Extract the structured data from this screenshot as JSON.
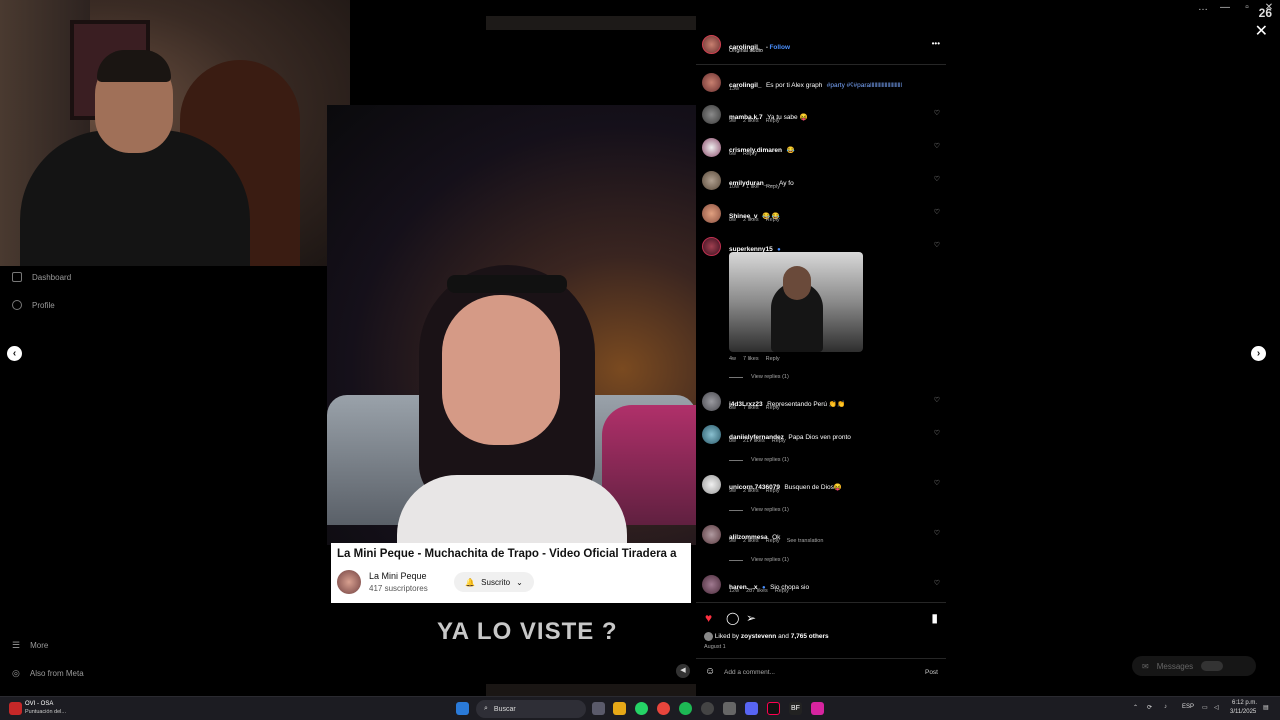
{
  "window": {
    "corner_number": "26",
    "controls": [
      "…",
      "—",
      "▫",
      "✕"
    ],
    "close_icon": "✕"
  },
  "sidebar": {
    "items": [
      {
        "label": "Dashboard",
        "icon": "dashboard-icon"
      },
      {
        "label": "Profile",
        "icon": "profile-icon"
      },
      {
        "label": "More",
        "icon": "menu-icon"
      },
      {
        "label": "Also from Meta",
        "icon": "meta-icon"
      }
    ]
  },
  "video": {
    "yt_title": "La Mini Peque - Muchachita de Trapo - Video Oficial Tiradera a",
    "yt_channel": "La Mini Peque",
    "yt_subscribers": "417 suscriptores",
    "yt_subscribe_label": "Suscrito",
    "overlay_text": "YA LO VISTE ?"
  },
  "post": {
    "author": "carolingil_",
    "follow_label": "Follow",
    "audio": "Original audio",
    "more_icon": "•••",
    "caption_user": "carolingil_",
    "caption_text": "Es por ti Alex graph",
    "caption_tags": "#party #ʕ#parallllllllllllllllllllll",
    "caption_time": "13w"
  },
  "comments": [
    {
      "user": "mamba.k.7",
      "text": "Ya tu sabe 😝",
      "time": "9w",
      "likes": "2 likes",
      "reply": "Reply"
    },
    {
      "user": "crismely.dimaren",
      "text": "😂",
      "time": "6w",
      "likes": "",
      "reply": "Reply"
    },
    {
      "user": "emilyduran___",
      "text": "Ay fo",
      "time": "10w",
      "likes": "1 like",
      "reply": "Reply"
    },
    {
      "user": "Shinee_v",
      "text": "😂 😂",
      "time": "8w",
      "likes": "2 likes",
      "reply": "Reply"
    },
    {
      "user": "superkenny15",
      "text": "",
      "time": "4w",
      "likes": "7 likes",
      "reply": "Reply",
      "view_replies": "View replies (1)"
    },
    {
      "user": "j4d3Lrxz23",
      "text": "Representando Perú 👏👏",
      "time": "8w",
      "likes": "7 likes",
      "reply": "Reply"
    },
    {
      "user": "daniielyfernandez",
      "text": "Papa Dios ven pronto",
      "time": "8w",
      "likes": "217 likes",
      "reply": "Reply",
      "view_replies": "View replies (1)"
    },
    {
      "user": "unicorn.7436079",
      "text": "Busquen de Dios😝",
      "time": "9w",
      "likes": "2 likes",
      "reply": "Reply",
      "view_replies": "View replies (1)"
    },
    {
      "user": "alilzommesa",
      "text": "Ok",
      "time": "9w",
      "likes": "2 likes",
      "reply": "Reply",
      "extra": "See translation",
      "view_replies": "View replies (1)"
    },
    {
      "user": "haren._.x",
      "text": "Sio chopa sio",
      "time": "12w",
      "likes": "287 likes",
      "reply": "Reply"
    }
  ],
  "footer": {
    "liked_by_prefix": "Liked by",
    "liked_by_user": "zoystevenn",
    "liked_by_and": "and",
    "liked_by_count": "7,765 others",
    "date": "August 1",
    "add_comment_placeholder": "Add a comment...",
    "post_label": "Post"
  },
  "messages_label": "Messages",
  "taskbar": {
    "app_title": "OVI - OSA",
    "app_subtitle": "Puntuación del...",
    "search_label": "Buscar",
    "lang": "ESP",
    "time": "6:12 p.m.",
    "date": "3/11/2025"
  },
  "colors": {
    "heart": "#ff3040",
    "link": "#4a90ff",
    "panel_bg": "#000000"
  }
}
